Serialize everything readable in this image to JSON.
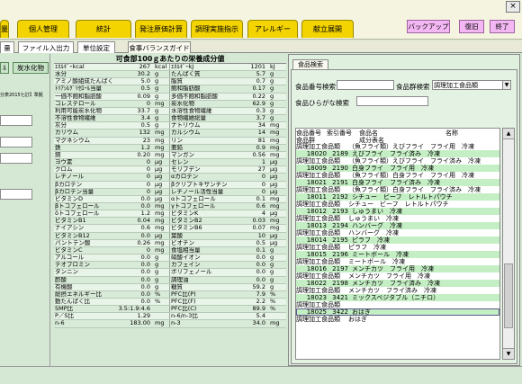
{
  "top_tabs": [
    "量",
    "個人管理",
    "統計",
    "発注原価計算",
    "調理実施指示",
    "アレルギー",
    "献立展開"
  ],
  "action_buttons": [
    "バックアップ",
    "復旧",
    "終了"
  ],
  "close_glyph": "×",
  "sub_tabs": [
    "量",
    "ファイル入出力",
    "単位設定",
    "食事バランスガイド"
  ],
  "left_chips": [
    "ﾙ",
    "炭水化物"
  ],
  "left_note": "分表2015七訂】準拠",
  "center_title": "可食部100ｇあたりの栄養成分値",
  "nutrients": [
    [
      "ｴﾈﾙｷﾞｰkcal",
      "267",
      "kcal",
      "ｴﾈﾙｷﾞｰkJ",
      "1201",
      "kJ"
    ],
    [
      "水分",
      "30.2",
      "g",
      "たんぱく質",
      "5.7",
      "g"
    ],
    [
      "アミノ酸組成たんぱく",
      "5.0",
      "g",
      "脂質",
      "0.7",
      "g"
    ],
    [
      "ﾄﾘｱｼﾙｸﾞﾘｾﾛｰﾙ当量",
      "0.5",
      "g",
      "飽和脂肪酸",
      "0.17",
      "g"
    ],
    [
      "一価不飽和脂肪酸",
      "0.09",
      "g",
      "多価不飽和脂肪酸",
      "0.22",
      "g"
    ],
    [
      "コレステロール",
      "0",
      "mg",
      "炭水化物",
      "62.9",
      "g"
    ],
    [
      "利用可能炭水化物",
      "33.7",
      "g",
      "水溶性食物繊維",
      "0.3",
      "g"
    ],
    [
      "不溶性食物繊維",
      "3.4",
      "g",
      "食物繊維総量",
      "3.7",
      "g"
    ],
    [
      "灰分",
      "0.5",
      "g",
      "ナトリウム",
      "34",
      "mg"
    ],
    [
      "カリウム",
      "132",
      "mg",
      "カルシウム",
      "14",
      "mg"
    ],
    [
      "マグネシウム",
      "23",
      "mg",
      "リン",
      "81",
      "mg"
    ],
    [
      "鉄",
      "1.2",
      "mg",
      "亜鉛",
      "0.9",
      "mg"
    ],
    [
      "銅",
      "0.20",
      "mg",
      "マンガン",
      "0.56",
      "mg"
    ],
    [
      "ヨウ素",
      "0",
      "μg",
      "セレン",
      "1",
      "μg"
    ],
    [
      "クロム",
      "0",
      "μg",
      "モリブデン",
      "27",
      "μg"
    ],
    [
      "レチノール",
      "0",
      "μg",
      "αカロテン",
      "0",
      "μg"
    ],
    [
      "βカロテン",
      "0",
      "μg",
      "βクリプトキサンチン",
      "0",
      "μg"
    ],
    [
      "βカロテン当量",
      "0",
      "μg",
      "レチノール活性当量",
      "0",
      "μg"
    ],
    [
      "ビタミンD",
      "0.0",
      "μg",
      "αトコフェロール",
      "0.1",
      "mg"
    ],
    [
      "βトコフェロール",
      "0.0",
      "mg",
      "γトコフェロール",
      "0.6",
      "mg"
    ],
    [
      "δトコフェロール",
      "1.2",
      "mg",
      "ビタミンK",
      "4",
      "μg"
    ],
    [
      "ビタミンB1",
      "0.04",
      "mg",
      "ビタミンB2",
      "0.03",
      "mg"
    ],
    [
      "ナイアシン",
      "0.6",
      "mg",
      "ビタミンB6",
      "0.07",
      "mg"
    ],
    [
      "ビタミンB12",
      "0.0",
      "μg",
      "葉酸",
      "10",
      "μg"
    ],
    [
      "パントテン酸",
      "0.26",
      "mg",
      "ビオチン",
      "0.5",
      "μg"
    ],
    [
      "ビタミンC",
      "0",
      "mg",
      "食塩相当量",
      "0.1",
      "g"
    ],
    [
      "アルコール",
      "0.0",
      "g",
      "硝酸イオン",
      "0.0",
      "g"
    ],
    [
      "テオブロミン",
      "0.0",
      "g",
      "カフェイン",
      "0.0",
      "g"
    ],
    [
      "タンニン",
      "0.0",
      "g",
      "ポリフェノール",
      "0.0",
      "g"
    ],
    [
      "酢酸",
      "0.0",
      "g",
      "調理油",
      "0.0",
      "g"
    ],
    [
      "有機酸",
      "0.0",
      "g",
      "糖質",
      "59.2",
      "g"
    ],
    [
      "総摂エネルギー比",
      "0.0",
      "%",
      "PFC比(P)",
      "7.9",
      "%"
    ],
    [
      "動たんぱく比",
      "0.0",
      "%",
      "PFC比(F)",
      "2.2",
      "%"
    ],
    [
      "SMP比",
      "3.5:1.9:4.6",
      "",
      "PFC比(C)",
      "89.9",
      "%"
    ],
    [
      "P／S比",
      "1.29",
      "",
      "n-6/n-3比",
      "5.4",
      ""
    ],
    [
      "n-6",
      "183.00",
      "mg",
      "n-3",
      "34.0",
      "mg"
    ]
  ],
  "panel": {
    "tab": "食品検索",
    "code_label": "食品番号検索",
    "group_label": "食品群検索",
    "group_value": "調理加工食品類",
    "hiragana_label": "食品ひらがな検索",
    "code_value": "",
    "hiragana_value": ""
  },
  "list_headers": {
    "line1": [
      "食品番号",
      "索引番号",
      "食品名",
      "名称"
    ],
    "line2": [
      "食品群",
      "成分表名"
    ]
  },
  "list_rows": [
    [
      "調理加工食品類",
      "",
      "",
      "（魚フライ類）えびフライ　フライ用　冷凍"
    ],
    [
      "",
      "18020",
      "2189",
      "えびフライ　フライ済み　冷凍"
    ],
    [
      "調理加工食品類",
      "",
      "",
      "（魚フライ類）えびフライ　フライ済み　冷凍"
    ],
    [
      "",
      "18009",
      "2190",
      "白身フライ　フライ用　冷凍"
    ],
    [
      "調理加工食品類",
      "",
      "",
      "（魚フライ類）白身フライ　フライ用　冷凍"
    ],
    [
      "",
      "18021",
      "2191",
      "白身フライ　フライ済み　冷凍"
    ],
    [
      "調理加工食品類",
      "",
      "",
      "（魚フライ類）白身フライ　フライ済み　冷凍"
    ],
    [
      "",
      "18011",
      "2192",
      "シチュー　ビーフ　レトルトパウチ"
    ],
    [
      "調理加工食品類",
      "",
      "",
      "シチュー　ビーフ　レトルトパウチ"
    ],
    [
      "",
      "18012",
      "2193",
      "しゅうまい　冷凍"
    ],
    [
      "調理加工食品類",
      "",
      "",
      "しゅうまい　冷凍"
    ],
    [
      "",
      "18013",
      "2194",
      "ハンバーグ　冷凍"
    ],
    [
      "調理加工食品類",
      "",
      "",
      "ハンバーグ　冷凍"
    ],
    [
      "",
      "18014",
      "2195",
      "ピラフ　冷凍"
    ],
    [
      "調理加工食品類",
      "",
      "",
      "ピラフ　冷凍"
    ],
    [
      "",
      "18015",
      "2196",
      "ミートボール　冷凍"
    ],
    [
      "調理加工食品類",
      "",
      "",
      "ミートボール　冷凍"
    ],
    [
      "",
      "18016",
      "2197",
      "メンチカツ　フライ用　冷凍"
    ],
    [
      "調理加工食品類",
      "",
      "",
      "メンチカツ　フライ用　冷凍"
    ],
    [
      "",
      "18022",
      "2198",
      "メンチカツ　フライ済み　冷凍"
    ],
    [
      "調理加工食品類",
      "",
      "",
      "メンチカツ　フライ済み　冷凍"
    ],
    [
      "",
      "18023",
      "3421",
      "ミックスベジタブル（ニチロ）"
    ],
    [
      "調理加工食品類",
      "",
      "",
      ""
    ],
    [
      "",
      "18025",
      "3422",
      "おはぎ"
    ],
    [
      "調理加工食品類",
      "",
      "",
      "おはぎ"
    ]
  ],
  "scroll": {
    "up": "▲",
    "down": "▼",
    "dropdown": "▼"
  }
}
